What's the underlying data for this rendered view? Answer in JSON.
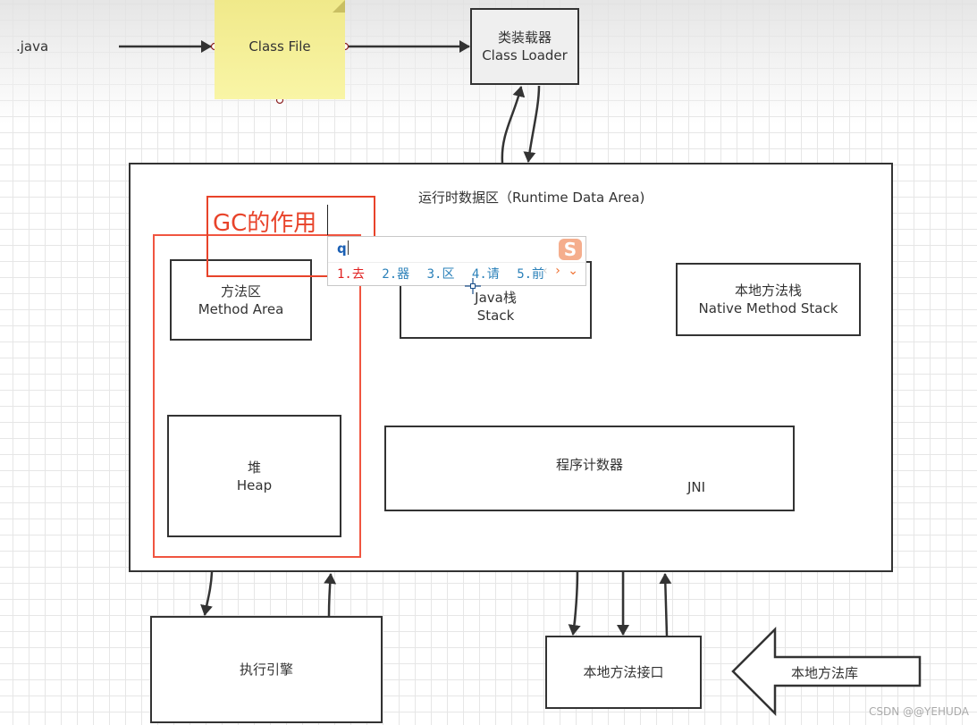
{
  "diagram": {
    "source_label": ".java",
    "class_file": "Class File",
    "class_loader": {
      "cn": "类装载器",
      "en": "Class Loader"
    },
    "runtime_area": {
      "title": "运行时数据区（Runtime Data Area)"
    },
    "method_area": {
      "cn": "方法区",
      "en": "Method Area"
    },
    "java_stack": {
      "cn": "Java栈",
      "en": "Stack"
    },
    "native_method_stack": {
      "cn": "本地方法栈",
      "en": "Native Method Stack"
    },
    "heap": {
      "cn": "堆",
      "en": "Heap"
    },
    "program_counter": "程序计数器",
    "jni_label": "JNI",
    "execution_engine": "执行引擎",
    "native_interface": "本地方法接口",
    "native_library": "本地方法库",
    "gc_annotation": "GC的作用",
    "watermark": "CSDN @@YEHUDA"
  },
  "ime": {
    "composition": "q",
    "candidates": [
      "1.去",
      "2.器",
      "3.区",
      "4.请",
      "5.前"
    ],
    "nav": {
      "prev": "‹",
      "next": "›",
      "expand": "⌄"
    },
    "logo_letter": "S"
  },
  "colors": {
    "annotation_red": "#e8432a",
    "note_yellow": "#f7f3a3",
    "stroke": "#333333",
    "ime_blue": "#2a80b9"
  }
}
